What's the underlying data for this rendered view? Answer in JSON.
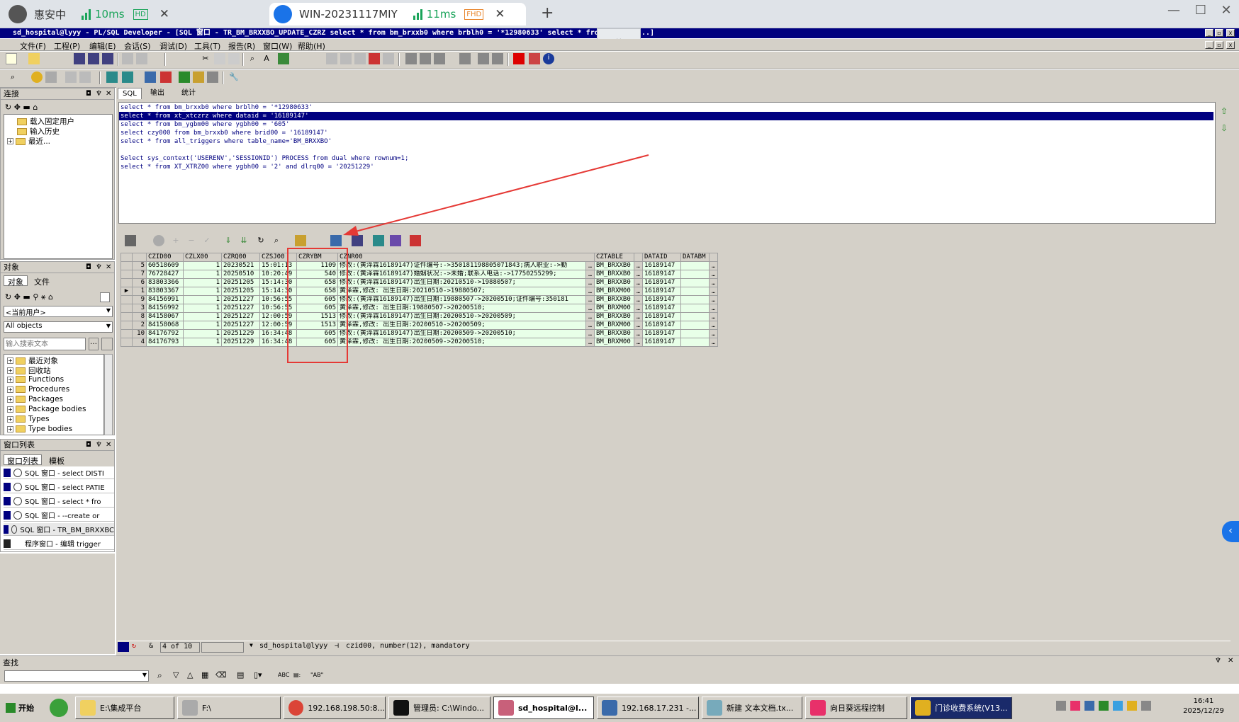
{
  "remote_tabs": [
    {
      "label": "惠安中",
      "latency": "10ms",
      "quality": "HD"
    },
    {
      "label": "WIN-20231117MIY",
      "latency": "11ms",
      "quality": "FHD"
    }
  ],
  "window": {
    "title": "sd_hospital@lyyy - PL/SQL Developer - [SQL 窗口 - TR_BM_BRXXBO_UPDATE_CZRZ select * from bm_brxxb0 where brblh0 = '*12980633' select * from xt_xtc ...]"
  },
  "menu": [
    "文件(F)",
    "工程(P)",
    "编辑(E)",
    "会话(S)",
    "调试(D)",
    "工具(T)",
    "报告(R)",
    "窗口(W)",
    "帮助(H)"
  ],
  "connection_panel": {
    "title": "连接",
    "items": [
      "载入固定用户",
      "输入历史",
      "最近..."
    ]
  },
  "object_panel": {
    "title": "对象",
    "tabs": [
      "对象",
      "文件"
    ],
    "user_select": "<当前用户>",
    "filter_select": "All objects",
    "search_placeholder": "输入搜索文本",
    "items": [
      "最近对象",
      "回收站",
      "Functions",
      "Procedures",
      "Packages",
      "Package bodies",
      "Types",
      "Type bodies"
    ]
  },
  "window_list_panel": {
    "title": "窗口列表",
    "tabs": [
      "窗口列表",
      "模板"
    ],
    "items": [
      "SQL 窗口 - select DISTI",
      "SQL 窗口 - select PATIE",
      "SQL 窗口 - select * fro",
      "SQL 窗口 - --create or",
      "SQL 窗口 - TR_BM_BRXXBC",
      "程序窗口 - 编辑 trigger"
    ]
  },
  "editor_tabs": [
    "SQL",
    "输出",
    "统计"
  ],
  "editor_lines": [
    "select * from bm_brxxb0 where brblh0 = '*12980633'",
    "select * from xt_xtczrz where dataid = '16189147'",
    "select * from bm_ygbm00 where ygbh00 = '605'",
    "select czy000 from bm_brxxb0 where brid00 = '16189147'",
    "select * from all_triggers where table_name='BM_BRXXBO'",
    "",
    "Select sys_context('USERENV','SESSIONID') PROCESS from dual where rownum=1;",
    "select * from XT_XTRZ00 where ygbh00 = '2' and dlrq00 = '20251229'"
  ],
  "result_grid": {
    "columns": [
      "CZID00",
      "CZLX00",
      "CZRQ00",
      "CZSJ00",
      "CZRYBM",
      "CZNR00",
      "CZTABLE",
      "DATAID",
      "DATABM"
    ],
    "rows": [
      {
        "rownum": "5",
        "CZID00": "60518609",
        "CZLX00": "1",
        "CZRQ00": "20230521",
        "CZSJ00": "15:01:13",
        "CZRYBM": "1109",
        "CZNR00": "修改:(黄泽霖16189147)证件编号:->350181198805071843;病人职业:->勤",
        "CZTABLE": "BM_BRXXB0",
        "DATAID": "16189147",
        "DATABM": ""
      },
      {
        "rownum": "7",
        "CZID00": "76728427",
        "CZLX00": "1",
        "CZRQ00": "20250510",
        "CZSJ00": "10:20:49",
        "CZRYBM": "540",
        "CZNR00": "修改:(黄泽霖16189147)婚姻状况:->未婚;联系人电话:->17750255299;",
        "CZTABLE": "BM_BRXXB0",
        "DATAID": "16189147",
        "DATABM": ""
      },
      {
        "rownum": "6",
        "CZID00": "83803366",
        "CZLX00": "1",
        "CZRQ00": "20251205",
        "CZSJ00": "15:14:30",
        "CZRYBM": "658",
        "CZNR00": "修改:(黄泽霖16189147)出生日期:20210510->19880507;",
        "CZTABLE": "BM_BRXXB0",
        "DATAID": "16189147",
        "DATABM": ""
      },
      {
        "rownum": "1",
        "CZID00": "83803367",
        "CZLX00": "1",
        "CZRQ00": "20251205",
        "CZSJ00": "15:14:30",
        "CZRYBM": "658",
        "CZNR00": "黄泽霖,修改: 出生日期:20210510->19880507;",
        "CZTABLE": "BM_BRXM00",
        "DATAID": "16189147",
        "DATABM": ""
      },
      {
        "rownum": "9",
        "CZID00": "84156991",
        "CZLX00": "1",
        "CZRQ00": "20251227",
        "CZSJ00": "10:56:55",
        "CZRYBM": "605",
        "CZNR00": "修改:(黄泽霖16189147)出生日期:19880507->20200510;证件编号:350181",
        "CZTABLE": "BM_BRXXB0",
        "DATAID": "16189147",
        "DATABM": ""
      },
      {
        "rownum": "3",
        "CZID00": "84156992",
        "CZLX00": "1",
        "CZRQ00": "20251227",
        "CZSJ00": "10:56:55",
        "CZRYBM": "605",
        "CZNR00": "黄泽霖,修改: 出生日期:19880507->20200510;",
        "CZTABLE": "BM_BRXM00",
        "DATAID": "16189147",
        "DATABM": ""
      },
      {
        "rownum": "8",
        "CZID00": "84158067",
        "CZLX00": "1",
        "CZRQ00": "20251227",
        "CZSJ00": "12:00:59",
        "CZRYBM": "1513",
        "CZNR00": "修改:(黄泽霖16189147)出生日期:20200510->20200509;",
        "CZTABLE": "BM_BRXXB0",
        "DATAID": "16189147",
        "DATABM": ""
      },
      {
        "rownum": "2",
        "CZID00": "84158068",
        "CZLX00": "1",
        "CZRQ00": "20251227",
        "CZSJ00": "12:00:59",
        "CZRYBM": "1513",
        "CZNR00": "黄泽霖,修改: 出生日期:20200510->20200509;",
        "CZTABLE": "BM_BRXM00",
        "DATAID": "16189147",
        "DATABM": ""
      },
      {
        "rownum": "10",
        "CZID00": "84176792",
        "CZLX00": "1",
        "CZRQ00": "20251229",
        "CZSJ00": "16:34:48",
        "CZRYBM": "605",
        "CZNR00": "修改:(黄泽霖16189147)出生日期:20200509->20200510;",
        "CZTABLE": "BM_BRXXB0",
        "DATAID": "16189147",
        "DATABM": ""
      },
      {
        "rownum": "4",
        "CZID00": "84176793",
        "CZLX00": "1",
        "CZRQ00": "20251229",
        "CZSJ00": "16:34:48",
        "CZRYBM": "605",
        "CZNR00": "黄泽霖,修改: 出生日期:20200509->20200510;",
        "CZTABLE": "BM_BRXM00",
        "DATAID": "16189147",
        "DATABM": ""
      }
    ]
  },
  "status_bar": {
    "record": "4 of 10",
    "connection": "sd_hospital@lyyy",
    "column_info": "czid00, number(12), mandatory"
  },
  "find_bar": {
    "title": "查找",
    "abc": "ABC",
    "ab_quoted": "\"AB\""
  },
  "taskbar": {
    "start": "开始",
    "tasks": [
      "E:\\集成平台",
      "F:\\",
      "192.168.198.50:8...",
      "管理员: C:\\Windo...",
      "sd_hospital@l...",
      "192.168.17.231 -...",
      "新建 文本文档.tx...",
      "向日葵远程控制",
      "门诊收费系统(V13..."
    ],
    "time": "16:41",
    "date": "2025/12/29"
  },
  "colors": {
    "title_bar": "#000080",
    "grid_row": "#e8ffe8",
    "highlight_box": "#e53935",
    "arrow": "#e53935"
  }
}
